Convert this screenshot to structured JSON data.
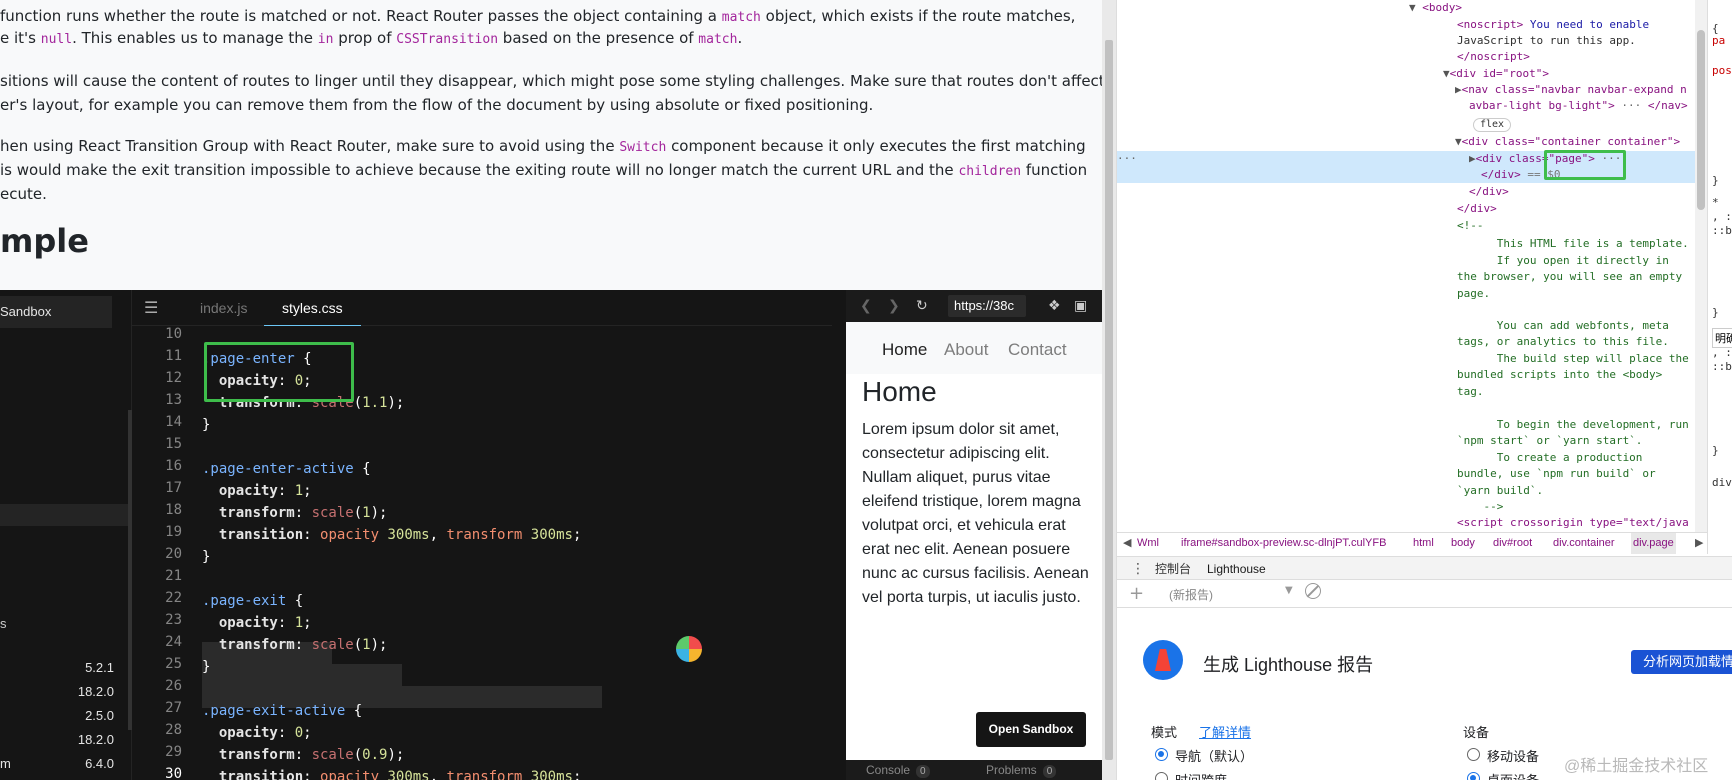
{
  "doc": {
    "para1_a": " function runs whether the route is matched or not. React Router passes the object containing a ",
    "para1_code1": "match",
    "para1_b": " object, which exists if the route matches,",
    "para2_a": "e it's ",
    "para2_code1": "null",
    "para2_b": ". This enables us to manage the ",
    "para2_code2": "in",
    "para2_c": " prop of ",
    "para2_code3": "CSSTransition",
    "para2_d": " based on the presence of ",
    "para2_code4": "match",
    "para2_e": ".",
    "para3": "sitions will cause the content of routes to linger until they disappear, which might pose some styling challenges. Make sure that routes don't affect",
    "para4": "er's layout, for example you can remove them from the flow of the document by using absolute or fixed positioning.",
    "para5_a": "hen using React Transition Group with React Router, make sure to avoid using the ",
    "para5_code": "Switch",
    "para5_b": " component because it only executes the first matching",
    "para6_a": "is would make the exit transition impossible to achieve because the exiting route will no longer match the current URL and the ",
    "para6_code": "children",
    "para6_b": " function",
    "para7": "ecute.",
    "heading": "mple"
  },
  "sandbox": {
    "sidebar_title": "Sandbox",
    "deps_head": "s",
    "deps": [
      {
        "name": "",
        "version": "5.2.1"
      },
      {
        "name": "",
        "version": "18.2.0"
      },
      {
        "name": "",
        "version": "2.5.0"
      },
      {
        "name": "",
        "version": "18.2.0"
      },
      {
        "name": "m",
        "version": "6.4.0"
      }
    ],
    "menu_icon": "hamburger-icon",
    "tabs": [
      "index.js",
      "styles.css"
    ],
    "line_numbers": [
      "10",
      "11",
      "12",
      "13",
      "14",
      "15",
      "16",
      "17",
      "18",
      "19",
      "20",
      "21",
      "22",
      "23",
      "24",
      "25",
      "26",
      "27",
      "28",
      "29",
      "30"
    ],
    "code": [
      "",
      ".page-enter {",
      "  opacity: 0;",
      "  transform: scale(1.1);",
      "}",
      "",
      ".page-enter-active {",
      "  opacity: 1;",
      "  transform: scale(1);",
      "  transition: opacity 300ms, transform 300ms;",
      "}",
      "",
      ".page-exit {",
      "  opacity: 1;",
      "  transform: scale(1);",
      "}",
      "",
      ".page-exit-active {",
      "  opacity: 0;",
      "  transform: scale(0.9);",
      "  transition: opacity 300ms, transform 300ms;"
    ]
  },
  "preview": {
    "url": "https://38c",
    "nav": [
      "Home",
      "About",
      "Contact"
    ],
    "heading": "Home",
    "body": "Lorem ipsum dolor sit amet, consectetur adipiscing elit. Nullam aliquet, purus vitae eleifend tristique, lorem magna volutpat orci, et vehicula erat erat nec elit. Aenean posuere nunc ac cursus facilisis. Aenean vel porta turpis, ut iaculis justo.",
    "open_button": "Open Sandbox",
    "console_label": "Console",
    "console_count": "0",
    "problems_label": "Problems",
    "problems_count": "0"
  },
  "devtools": {
    "dom_lines": {
      "body": "<body>",
      "noscript_open": "<noscript>",
      "noscript_text": " You need to enable",
      "noscript_text2": "JavaScript to run this app.",
      "noscript_close": "</noscript>",
      "root": "<div id=\"root\">",
      "nav1": "<nav class=\"navbar navbar-expand n",
      "nav2": "avbar-light bg-light\">",
      "nav_close": "</nav>",
      "flex": "flex",
      "container": "<div class=\"container container\">",
      "page": "<div class=\"page\">",
      "div_close1": "</div>",
      "eq": " == $0",
      "div_close2": "</div>",
      "div_close3": "</div>",
      "comment_open": "<!--",
      "c1": "      This HTML file is a template.",
      "c2": "      If you open it directly in",
      "c3": "the browser, you will see an empty",
      "c4": "page.",
      "c5": "      You can add webfonts, meta",
      "c6": "tags, or analytics to this file.",
      "c7": "      The build step will place the",
      "c8": "bundled scripts into the <body>",
      "c9": "tag.",
      "c10": "      To begin the development, run",
      "c11": "`npm start` or `yarn start`.",
      "c12": "      To create a production",
      "c13": "bundle, use `npm run build` or",
      "c14": "`yarn build`.",
      "c15": "    -->",
      "script": "<script crossorigin type=\"text/java"
    },
    "breadcrumbs": [
      "Wml",
      "iframe#sandbox-preview.sc-dlnjPT.culYFB",
      "html",
      "body",
      "div#root",
      "div.container",
      "div.page"
    ],
    "styles_snips": [
      "{",
      "pa",
      "pos",
      "}",
      "*",
      ", :",
      "::b",
      "}",
      "}",
      ", :",
      "::b",
      "}",
      "div"
    ],
    "tooltip": "明确性",
    "drawer_tabs": [
      "控制台",
      "Lighthouse"
    ],
    "report_placeholder": "(新报告)",
    "lh_title": "生成 Lighthouse 报告",
    "lh_analyze": "分析网页加载情况",
    "mode_label": "模式",
    "learn_more": "了解详情",
    "mode_options": [
      "导航（默认）",
      "时间跨度"
    ],
    "device_label": "设备",
    "device_options": [
      "移动设备",
      "桌面设备"
    ]
  },
  "watermark": "@稀土掘金技术社区",
  "colors": {
    "highlight_box": "#3ebd4b",
    "editor_bg": "#151515",
    "selected_dom_row": "#cfe8fc",
    "lh_button": "#1a53d4"
  }
}
